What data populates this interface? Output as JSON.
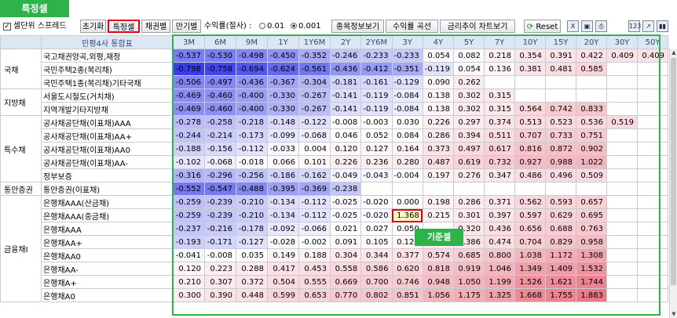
{
  "annotations": {
    "top": "특정셀",
    "base": "기준셀"
  },
  "toolbar": {
    "checkbox_label": "셀단위 스프레드",
    "reset_button": "초기화",
    "special_cell_button": "특정셀",
    "bond_button": "채권별",
    "maturity_button": "만기별",
    "yield_label": "수익률(절사) :",
    "radio_001": "0.01",
    "radio_0001": "0.001",
    "issue_info_button": "종목정보보기",
    "yield_curve_button": "수익률 곡선",
    "rate_trend_button": "금리추이 차트보기",
    "reset_label": "Reset",
    "icons": [
      "excel-icon",
      "copy-icon",
      "print-icon",
      "sort-123-icon",
      "chart-icon",
      "bar-chart-icon"
    ]
  },
  "grid": {
    "header_label": "민평4사 통합표",
    "columns": [
      "3M",
      "6M",
      "9M",
      "1Y",
      "1Y6M",
      "2Y",
      "2Y6M",
      "3Y",
      "4Y",
      "5Y",
      "7Y",
      "10Y",
      "15Y",
      "20Y",
      "30Y",
      "50Y"
    ],
    "groups": [
      {
        "category": "국채",
        "rows": [
          {
            "name": "국고채권양곡,외평,재정",
            "values": [
              "-0.537",
              "-0.530",
              "-0.498",
              "-0.450",
              "-0.352",
              "-0.246",
              "-0.233",
              "-0.233",
              "0.054",
              "0.082",
              "0.218",
              "0.354",
              "0.391",
              "0.422",
              "0.409",
              "0.409"
            ]
          },
          {
            "name": "국민주택2종(복리채)",
            "values": [
              "-0.798",
              "-0.758",
              "-0.694",
              "-0.624",
              "-0.561",
              "-0.436",
              "-0.412",
              "-0.351",
              "-0.119",
              "0.054",
              "0.136",
              "0.381",
              "0.481",
              "0.585",
              "",
              ""
            ]
          },
          {
            "name": "국민주택1종(복리채)기타국채",
            "values": [
              "-0.506",
              "-0.497",
              "-0.436",
              "-0.367",
              "-0.304",
              "-0.181",
              "-0.161",
              "-0.129",
              "0.090",
              "0.262",
              "",
              "",
              "",
              "",
              "",
              ""
            ]
          }
        ]
      },
      {
        "category": "지방채",
        "rows": [
          {
            "name": "서울도시철도(거치채)",
            "values": [
              "-0.469",
              "-0.460",
              "-0.400",
              "-0.330",
              "-0.267",
              "-0.141",
              "-0.119",
              "-0.084",
              "0.138",
              "0.302",
              "0.315",
              "",
              "",
              "",
              "",
              ""
            ]
          },
          {
            "name": "지역개발기타지방채",
            "values": [
              "-0.469",
              "-0.460",
              "-0.400",
              "-0.330",
              "-0.267",
              "-0.141",
              "-0.119",
              "-0.084",
              "0.138",
              "0.302",
              "0.315",
              "0.564",
              "0.742",
              "0.833",
              "",
              ""
            ]
          }
        ]
      },
      {
        "category": "특수채",
        "rows": [
          {
            "name": "공사채공단채(이표채)AAA",
            "values": [
              "-0.278",
              "-0.258",
              "-0.218",
              "-0.148",
              "-0.122",
              "-0.008",
              "-0.003",
              "0.030",
              "0.226",
              "0.297",
              "0.374",
              "0.513",
              "0.523",
              "0.536",
              "0.519",
              ""
            ]
          },
          {
            "name": "공사채공단채(이표채)AA+",
            "values": [
              "-0.244",
              "-0.214",
              "-0.173",
              "-0.099",
              "-0.068",
              "0.046",
              "0.052",
              "0.084",
              "0.286",
              "0.394",
              "0.511",
              "0.707",
              "0.733",
              "0.751",
              "",
              ""
            ]
          },
          {
            "name": "공사채공단채(이표채)AA0",
            "values": [
              "-0.188",
              "-0.156",
              "-0.112",
              "-0.033",
              "0.004",
              "0.120",
              "0.127",
              "0.164",
              "0.373",
              "0.497",
              "0.617",
              "0.816",
              "0.872",
              "0.902",
              "",
              ""
            ]
          },
          {
            "name": "공사채공단채(이표채)AA-",
            "values": [
              "-0.102",
              "-0.068",
              "-0.018",
              "0.066",
              "0.101",
              "0.226",
              "0.236",
              "0.280",
              "0.487",
              "0.619",
              "0.732",
              "0.927",
              "0.988",
              "1.022",
              "",
              ""
            ]
          },
          {
            "name": "정부보증",
            "values": [
              "-0.316",
              "-0.296",
              "-0.256",
              "-0.186",
              "-0.162",
              "-0.049",
              "-0.043",
              "-0.004",
              "0.197",
              "0.276",
              "0.347",
              "0.486",
              "0.496",
              "0.509",
              "",
              ""
            ]
          }
        ]
      },
      {
        "category": "통안증권",
        "rows": [
          {
            "name": "통안증권(이표채)",
            "values": [
              "-0.552",
              "-0.547",
              "-0.488",
              "-0.395",
              "-0.369",
              "-0.238",
              "",
              "",
              "",
              "",
              "",
              "",
              "",
              "",
              "",
              ""
            ]
          }
        ]
      },
      {
        "category": "금융채Ⅰ",
        "rows": [
          {
            "name": "은행채AAA(산금채)",
            "values": [
              "-0.259",
              "-0.239",
              "-0.210",
              "-0.134",
              "-0.112",
              "-0.025",
              "-0.020",
              "0.000",
              "0.198",
              "0.286",
              "0.371",
              "0.562",
              "0.593",
              "0.657",
              "",
              ""
            ]
          },
          {
            "name": "은행채AAA(중금채)",
            "values": [
              "-0.259",
              "-0.239",
              "-0.210",
              "-0.134",
              "-0.112",
              "-0.025",
              "-0.020",
              "1.368",
              "0.215",
              "0.301",
              "0.397",
              "0.597",
              "0.629",
              "0.695",
              "",
              ""
            ]
          },
          {
            "name": "은행채AAA",
            "values": [
              "-0.237",
              "-0.216",
              "-0.178",
              "-0.092",
              "-0.066",
              "0.021",
              "0.027",
              "0.050",
              "",
              "0.320",
              "0.436",
              "0.656",
              "0.688",
              "0.763",
              "",
              ""
            ]
          },
          {
            "name": "은행채AA+",
            "values": [
              "-0.193",
              "-0.171",
              "-0.127",
              "-0.028",
              "-0.002",
              "0.091",
              "0.105",
              "0.126",
              "0.320",
              "0.386",
              "0.474",
              "0.704",
              "0.829",
              "0.958",
              "",
              ""
            ]
          },
          {
            "name": "은행채AA0",
            "values": [
              "-0.041",
              "-0.008",
              "0.035",
              "0.149",
              "0.188",
              "0.304",
              "0.344",
              "0.377",
              "0.574",
              "0.685",
              "0.800",
              "1.038",
              "1.172",
              "1.308",
              "",
              ""
            ]
          },
          {
            "name": "은행채AA-",
            "values": [
              "0.120",
              "0.223",
              "0.288",
              "0.417",
              "0.453",
              "0.558",
              "0.586",
              "0.620",
              "0.818",
              "0.919",
              "1.046",
              "1.349",
              "1.409",
              "1.532",
              "",
              ""
            ]
          },
          {
            "name": "은행채A+",
            "values": [
              "0.210",
              "0.307",
              "0.372",
              "0.504",
              "0.555",
              "0.669",
              "0.700",
              "0.746",
              "0.948",
              "1.050",
              "1.199",
              "1.526",
              "1.621",
              "1.744",
              "",
              ""
            ]
          },
          {
            "name": "은행채A0",
            "values": [
              "0.300",
              "0.390",
              "0.448",
              "0.599",
              "0.653",
              "0.770",
              "0.802",
              "0.851",
              "1.056",
              "1.175",
              "1.325",
              "1.668",
              "1.755",
              "1.883",
              "",
              ""
            ]
          }
        ]
      }
    ]
  }
}
